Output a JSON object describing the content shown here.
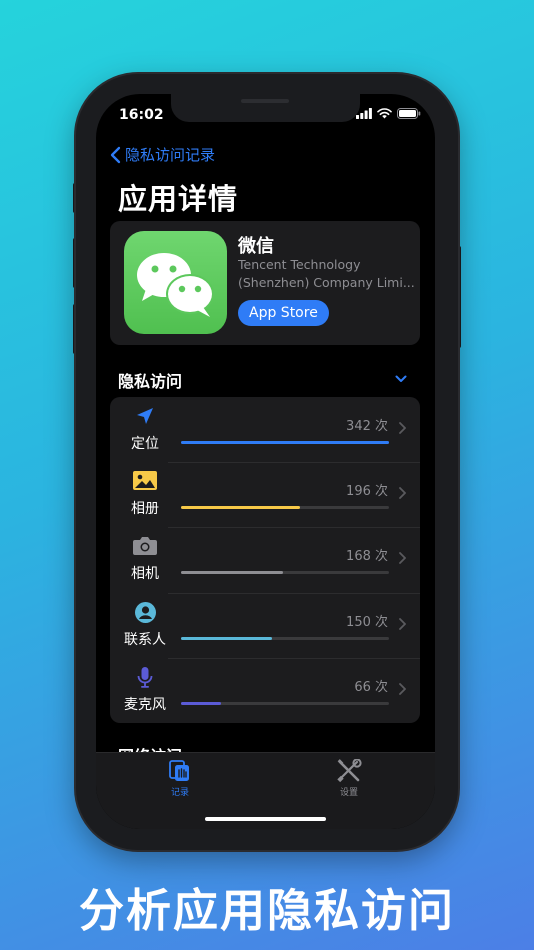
{
  "status_bar": {
    "time": "16:02"
  },
  "nav": {
    "back_label": "隐私访问记录"
  },
  "page": {
    "title": "应用详情"
  },
  "app": {
    "name": "微信",
    "developer_line1": "Tencent Technology",
    "developer_line2": "(Shenzhen) Company Limi...",
    "store_button": "App Store"
  },
  "privacy_section": {
    "title": "隐私访问",
    "items": [
      {
        "label": "定位",
        "count": "342 次",
        "value": 342,
        "icon": "location-arrow-icon",
        "color": "#2f7cf6"
      },
      {
        "label": "相册",
        "count": "196 次",
        "value": 196,
        "icon": "photo-icon",
        "color": "#f7c948"
      },
      {
        "label": "相机",
        "count": "168 次",
        "value": 168,
        "icon": "camera-icon",
        "color": "#8e8e93"
      },
      {
        "label": "联系人",
        "count": "150 次",
        "value": 150,
        "icon": "contact-icon",
        "color": "#5ab8d9"
      },
      {
        "label": "麦克风",
        "count": "66 次",
        "value": 66,
        "icon": "microphone-icon",
        "color": "#5b5bd6"
      }
    ],
    "max_value": 342
  },
  "network_section": {
    "title": "网络访问"
  },
  "tabbar": {
    "records": "记录",
    "settings": "设置"
  },
  "caption": "分析应用隐私访问",
  "colors": {
    "accent": "#2f7cf6",
    "card": "#1c1c1e",
    "background_top": "#25d3dc",
    "background_bottom": "#4c7fe6"
  }
}
